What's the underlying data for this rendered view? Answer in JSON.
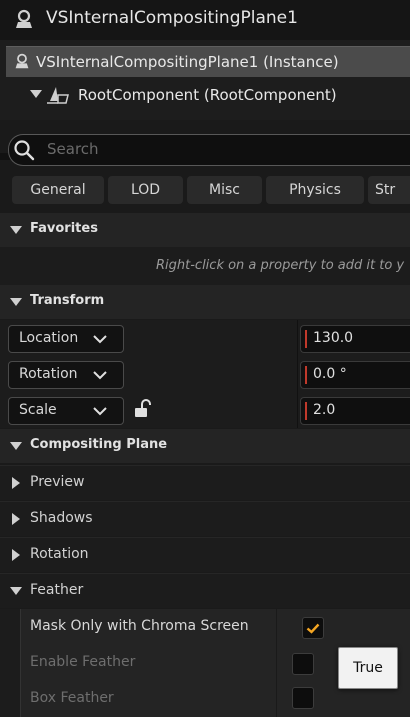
{
  "titlebar": {
    "title": "VSInternalCompositingPlane1",
    "icon": "actor-icon"
  },
  "tree": {
    "instance": "VSInternalCompositingPlane1 (Instance)",
    "root": "RootComponent (RootComponent)"
  },
  "search": {
    "placeholder": "Search"
  },
  "tabs": [
    "General",
    "LOD",
    "Misc",
    "Physics",
    "Str"
  ],
  "favorites": {
    "label": "Favorites",
    "hint": "Right-click on a property to add it to y"
  },
  "transform": {
    "label": "Transform",
    "rows": [
      {
        "label": "Location",
        "value": "130.0"
      },
      {
        "label": "Rotation",
        "value": "0.0 °"
      },
      {
        "label": "Scale",
        "value": "2.0"
      }
    ]
  },
  "compositing_plane": {
    "label": "Compositing Plane",
    "subsections": [
      "Preview",
      "Shadows",
      "Rotation",
      "Feather"
    ]
  },
  "feather_props": [
    {
      "label": "Mask Only with Chroma Screen",
      "checked": true,
      "enabled": true
    },
    {
      "label": "Enable Feather",
      "checked": false,
      "enabled": false
    },
    {
      "label": "Box Feather",
      "checked": false,
      "enabled": false
    }
  ],
  "tooltip": {
    "text": "True"
  },
  "colors": {
    "accent": "#f5a623",
    "value_marker": "#c0392b",
    "background": "#1a1a1a"
  }
}
